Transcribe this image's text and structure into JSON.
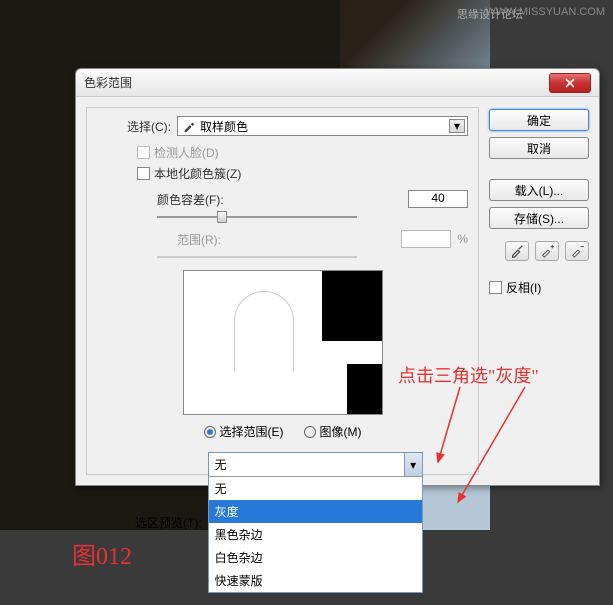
{
  "watermark": {
    "site": "WWW.MISSYUAN.COM",
    "forum": "思缘设计论坛"
  },
  "figure_label": "图012",
  "dialog": {
    "title": "色彩范围",
    "select_label": "选择(C):",
    "select_value": "取样颜色",
    "detect_faces": "检测人脸(D)",
    "localized": "本地化颜色簇(Z)",
    "fuzziness_label": "颜色容差(F):",
    "fuzziness_value": "40",
    "range_label": "范围(R):",
    "range_unit": "%",
    "radio_selection": "选择范围(E)",
    "radio_image": "图像(M)",
    "preview_label": "选区预览(T):",
    "dropdown_selected": "无",
    "dropdown_options": [
      "无",
      "灰度",
      "黑色杂边",
      "白色杂边",
      "快速蒙版"
    ]
  },
  "buttons": {
    "ok": "确定",
    "cancel": "取消",
    "load": "载入(L)...",
    "save": "存储(S)...",
    "invert": "反相(I)"
  },
  "annotation": "点击三角选\"灰度\""
}
